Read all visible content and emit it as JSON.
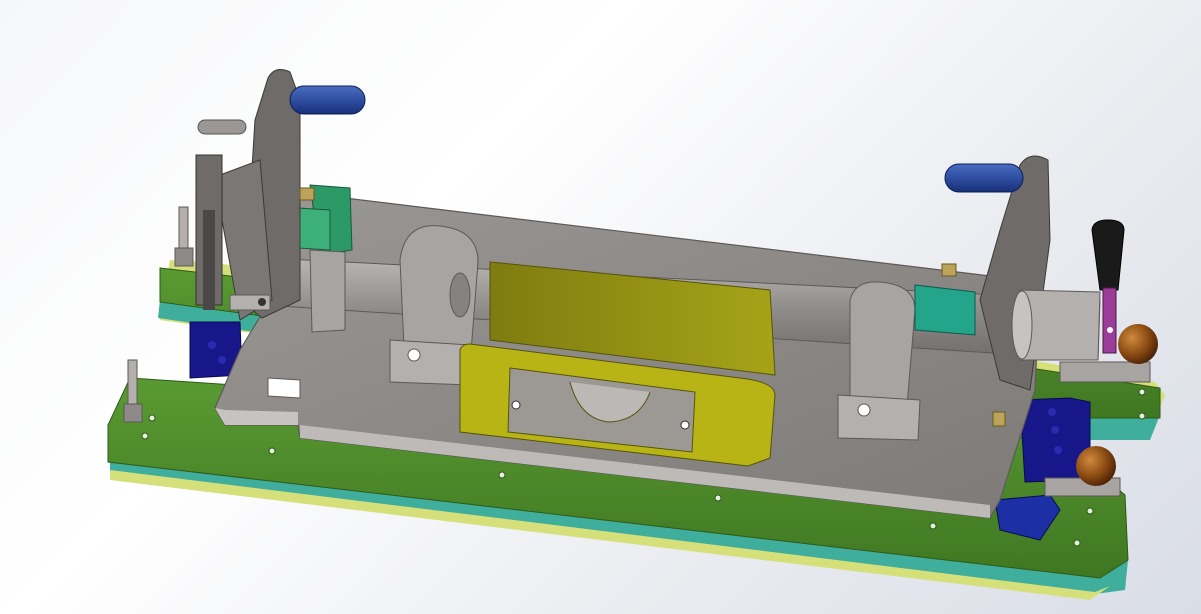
{
  "viewport": {
    "name": "cad-3d-viewport",
    "background_top": "#f4f5f8",
    "background_bottom": "#d9dde6"
  },
  "model": {
    "description_icon": "fixture-assembly-icon",
    "colors": {
      "plate_gray": "#8d8a87",
      "plate_edge": "#6e6b68",
      "base_green": "#4f8a2a",
      "base_teal": "#3fae9c",
      "base_yellow": "#d6e07a",
      "clamp_blue": "#1b3d8f",
      "block_navy": "#17178a",
      "block_teal": "#22a58a",
      "bracket_olive": "#8c8a12",
      "bracket_yellow": "#c6c418",
      "pin_purple": "#9b3c98",
      "knob_brown": "#7a3b08",
      "handle_black": "#1a1a1a"
    }
  }
}
